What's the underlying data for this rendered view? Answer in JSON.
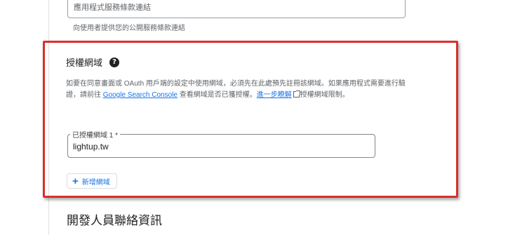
{
  "tos_field": {
    "placeholder": "應用程式服務條款連結",
    "helper": "向使用者提供您的公開服務條款連結"
  },
  "authorized_domains": {
    "title": "授權網域",
    "help_icon": "help-icon",
    "description_1": "如要在同意畫面或 OAuth 用戶端的設定中使用網域，必須先在此處預先註冊該網域。如果應用程式需要進行驗證，請前往",
    "console_link": "Google Search Console",
    "description_2": "查看網域是否已獲授權。",
    "learn_more_link": "進一步瞭解",
    "description_3": "授權網域限制。",
    "field_label": "已授權網域 1 *",
    "field_value": "lightup.tw",
    "add_button_label": "新增網域"
  },
  "developer_section": {
    "title": "開發人員聯絡資訊"
  },
  "colors": {
    "highlight": "#d9302c",
    "link": "#1a73e8"
  }
}
